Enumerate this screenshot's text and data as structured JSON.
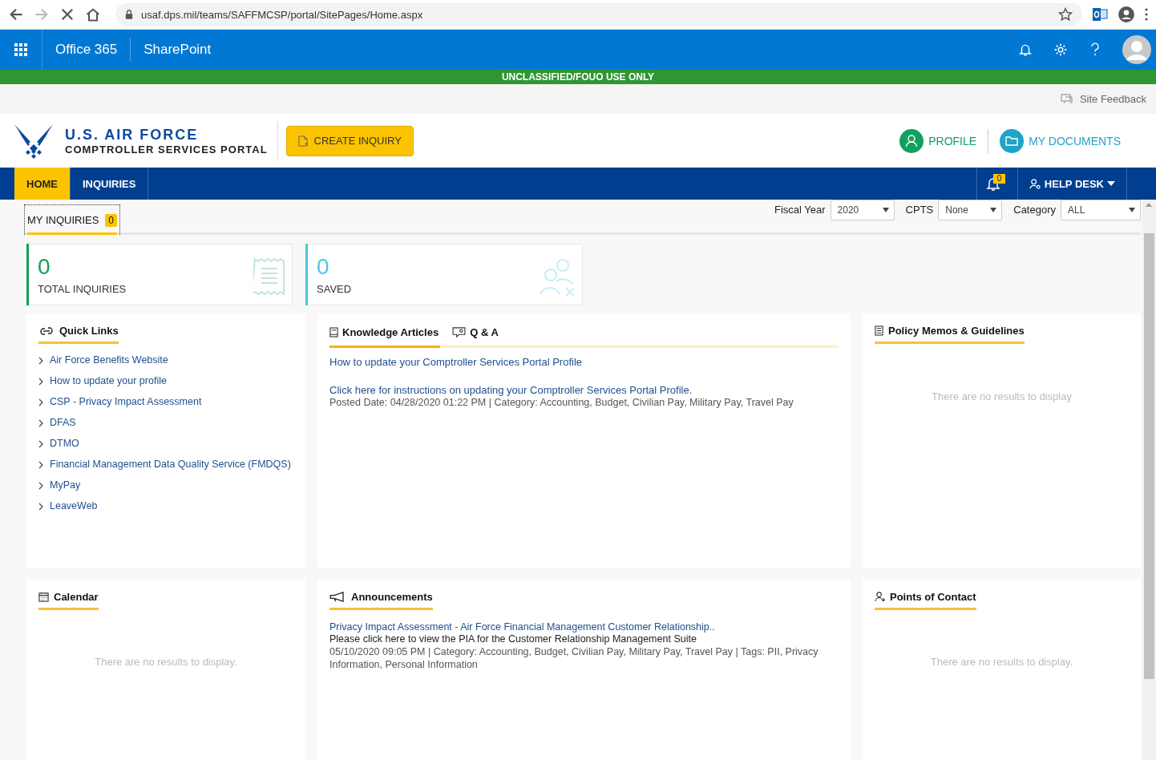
{
  "browser": {
    "url": "usaf.dps.mil/teams/SAFFMCSP/portal/SitePages/Home.aspx"
  },
  "suite_bar": {
    "brand": "Office 365",
    "app": "SharePoint"
  },
  "classification_banner": "UNCLASSIFIED/FOUO USE ONLY",
  "site_feedback": "Site Feedback",
  "header": {
    "title": "U.S. AIR FORCE",
    "subtitle": "COMPTROLLER SERVICES PORTAL",
    "create_button": "CREATE INQUIRY",
    "profile": "PROFILE",
    "documents": "MY DOCUMENTS"
  },
  "nav": {
    "tabs": [
      {
        "label": "HOME",
        "selected": true
      },
      {
        "label": "INQUIRIES",
        "selected": false
      }
    ],
    "notification_count": "0",
    "help_desk": "HELP DESK"
  },
  "filters": {
    "tab": {
      "label": "MY INQUIRIES",
      "count": "0"
    },
    "selects": [
      {
        "label": "Fiscal Year",
        "value": "2020"
      },
      {
        "label": "CPTS",
        "value": "None"
      },
      {
        "label": "Category",
        "value": "ALL"
      }
    ]
  },
  "stats": [
    {
      "value": "0",
      "label": "TOTAL INQUIRIES",
      "color": "#10a050",
      "kind": "receipt"
    },
    {
      "value": "0",
      "label": "SAVED",
      "color": "#4ec9db",
      "kind": "people"
    }
  ],
  "quick_links": {
    "title": "Quick Links",
    "items": [
      "Air Force Benefits Website",
      "How to update your profile",
      "CSP - Privacy Impact Assessment",
      "DFAS",
      "DTMO",
      "Financial Management Data Quality Service (FMDQS)",
      "MyPay",
      "LeaveWeb"
    ]
  },
  "knowledge": {
    "tabs": [
      {
        "label": "Knowledge Articles",
        "selected": true
      },
      {
        "label": "Q & A",
        "selected": false
      }
    ],
    "articles": [
      {
        "title": "How to update your Comptroller Services Portal Profile",
        "link": "Click here for instructions on updating your Comptroller Services Portal Profile.",
        "meta": "Posted Date: 04/28/2020 01:22 PM | Category: Accounting, Budget, Civilian Pay, Military Pay, Travel Pay"
      }
    ]
  },
  "policy": {
    "title": "Policy Memos & Guidelines",
    "empty": "There are no results to display"
  },
  "calendar": {
    "title": "Calendar",
    "empty": "There are no results to display."
  },
  "announcements": {
    "title": "Announcements",
    "items": [
      {
        "title": "Privacy Impact Assessment - Air Force Financial Management Customer Relationship..",
        "description": "Please click here to view the PIA for the Customer Relationship Management Suite",
        "meta": "05/10/2020 09:05 PM | Category: Accounting, Budget, Civilian Pay, Military Pay, Travel Pay | Tags: PII, Privacy Information, Personal Information"
      }
    ]
  },
  "contacts": {
    "title": "Points of Contact",
    "empty": "There are no results to display."
  }
}
